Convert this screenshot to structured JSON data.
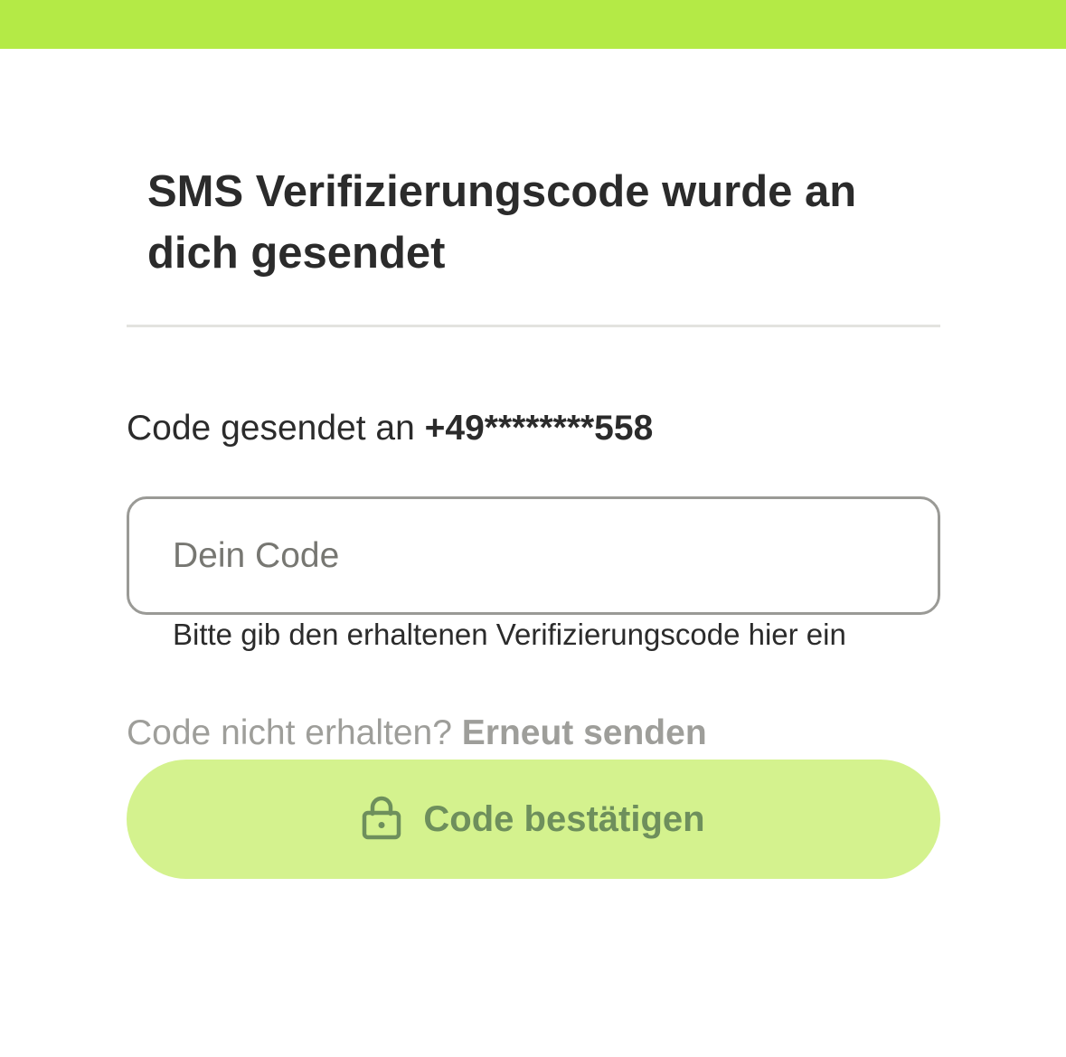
{
  "title": "SMS Verifizierungscode wurde an dich gesendet",
  "sent_to": {
    "prefix": "Code gesendet an ",
    "phone": "+49********558"
  },
  "code_input": {
    "placeholder": "Dein Code",
    "value": ""
  },
  "helper_text": "Bitte gib den erhaltenen Verifizierungscode hier ein",
  "resend": {
    "question": "Code nicht erhalten? ",
    "link_label": "Erneut senden"
  },
  "confirm_button": {
    "label": "Code bestätigen",
    "icon": "lock-icon"
  },
  "colors": {
    "top_bar": "#b4ea46",
    "button_bg": "#d4f28e",
    "button_text": "#6e8f5c"
  }
}
